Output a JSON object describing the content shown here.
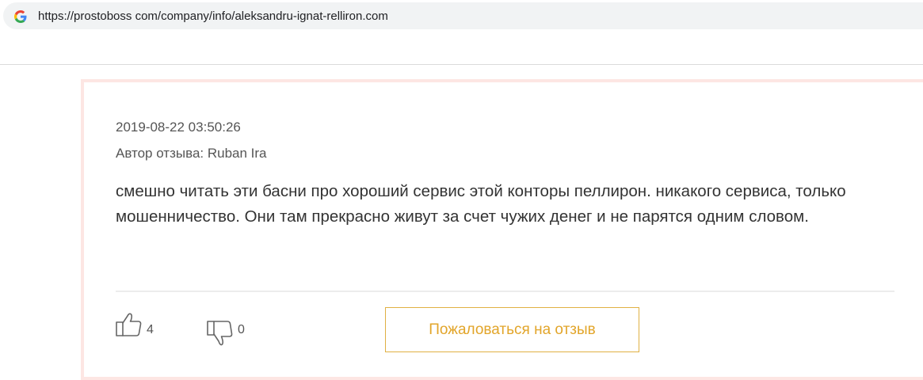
{
  "browser": {
    "url": "https://prostoboss com/company/info/aleksandru-ignat-relliron.com",
    "search_icon": "google-g-icon"
  },
  "review": {
    "date": "2019-08-22 03:50:26",
    "author_line": "Автор отзыва: Ruban Ira",
    "text": "смешно читать эти басни про хороший сервис этой конторы пеллирон. никакого сервиса, только мошенничество. Они там прекрасно живут за счет чужих денег и не парятся одним словом.",
    "likes": "4",
    "dislikes": "0",
    "report_label": "Пожаловаться на отзыв",
    "icons": {
      "like": "thumbs-up-icon",
      "dislike": "thumbs-down-icon"
    },
    "colors": {
      "card_border": "#fde6e3",
      "report_accent": "#e2a52a"
    }
  }
}
